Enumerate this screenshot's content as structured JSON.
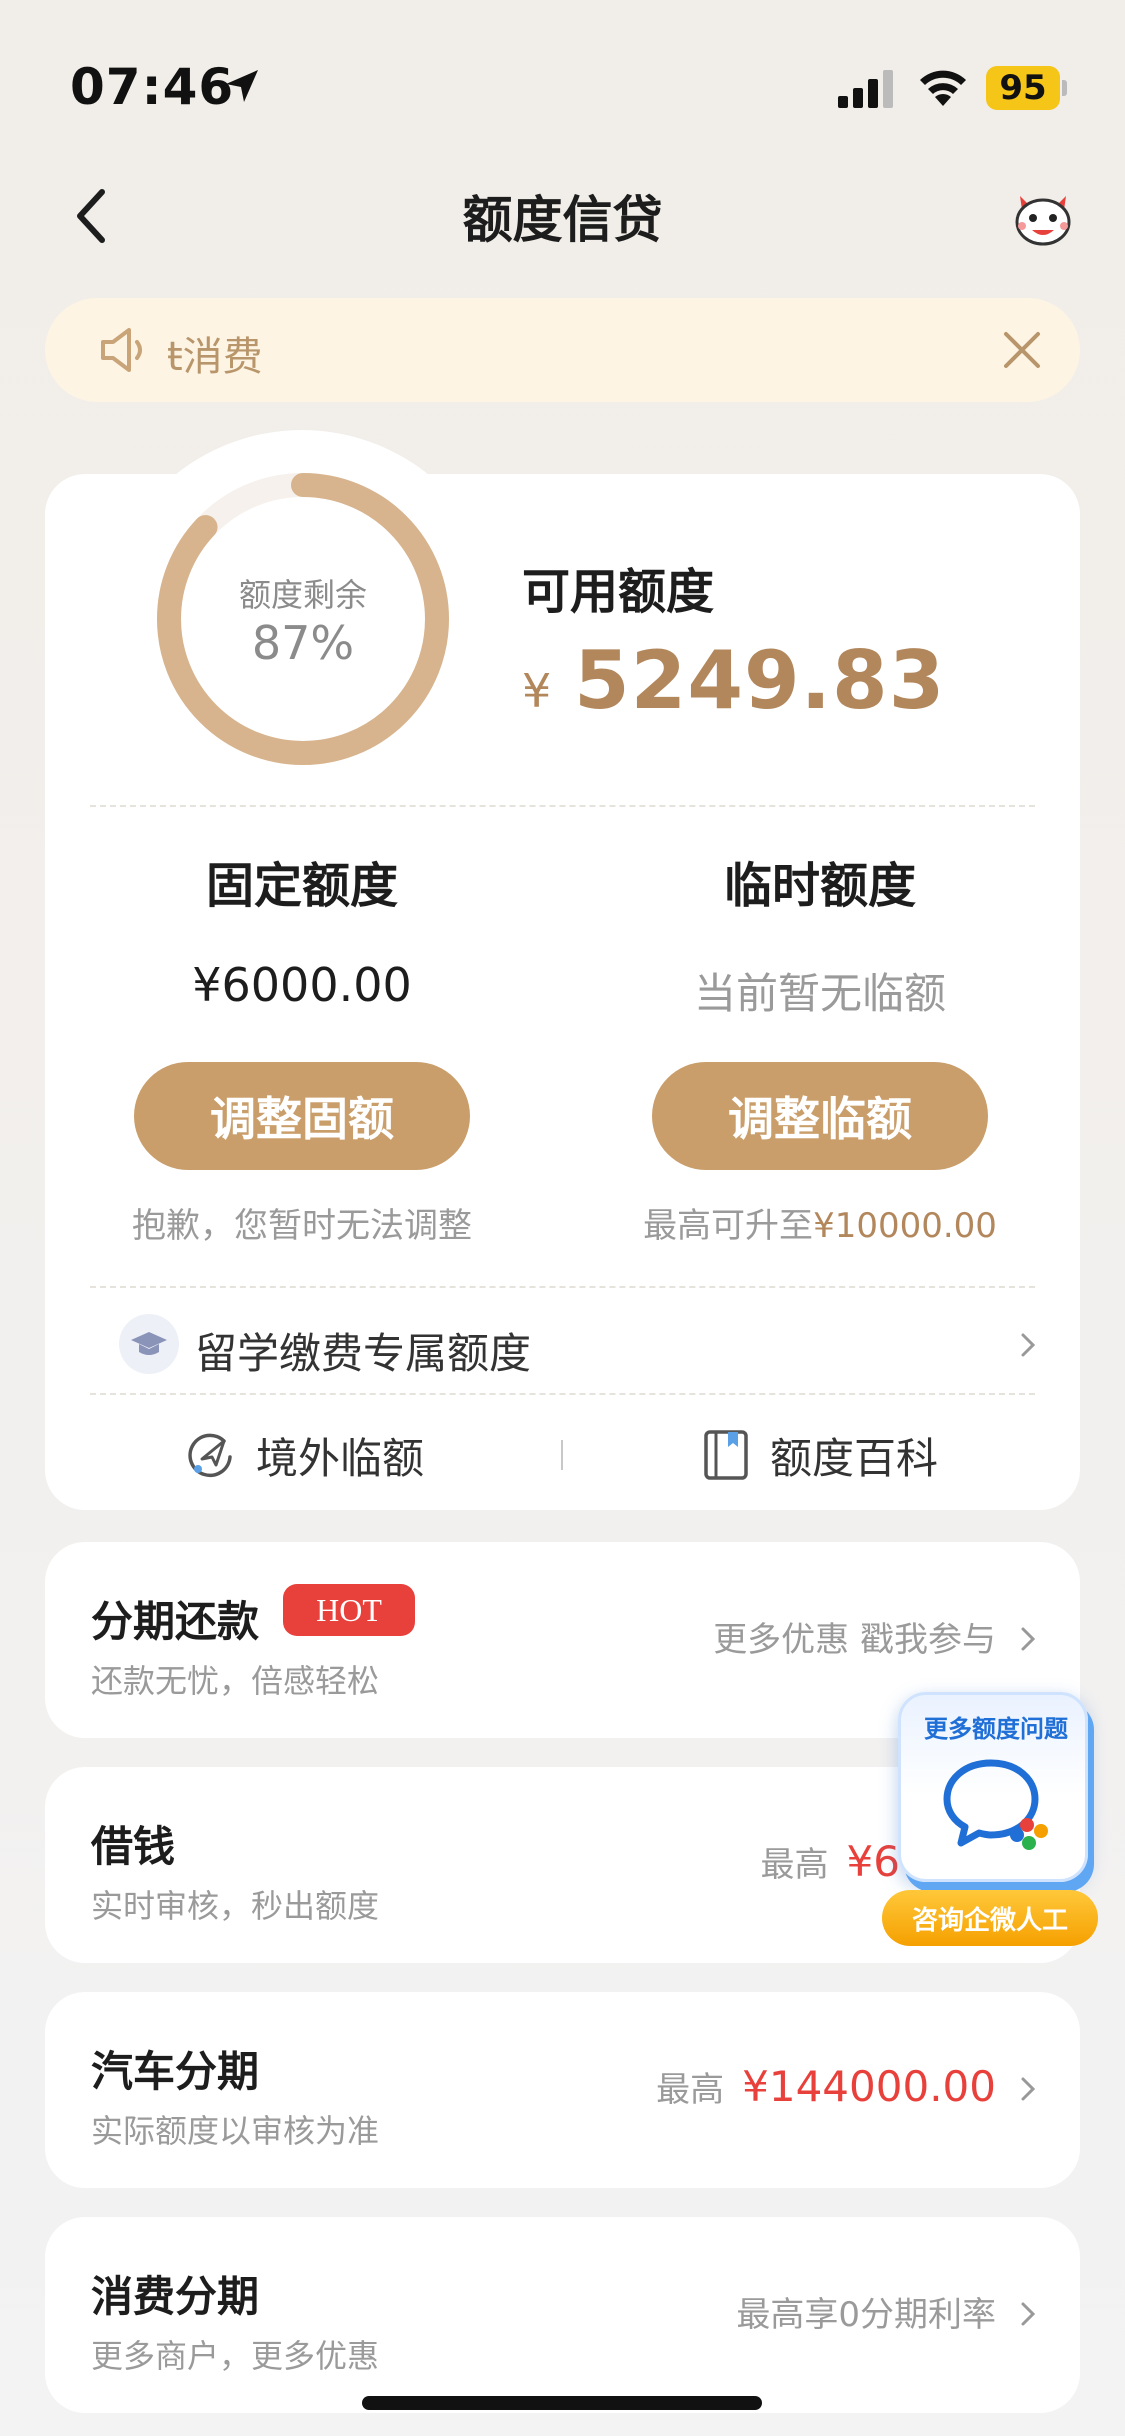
{
  "status_bar": {
    "time": "07:46",
    "battery": "95"
  },
  "nav": {
    "title": "额度信贷"
  },
  "notice": {
    "text": "ŧ消费"
  },
  "credit": {
    "ring_label": "额度剩余",
    "ring_percent": "87%",
    "ring_fraction": 0.87,
    "available_label": "可用额度",
    "currency": "¥",
    "available_amount": "5249.83",
    "fixed": {
      "title": "固定额度",
      "value": "¥6000.00",
      "button": "调整固额",
      "note": "抱歉，您暂时无法调整"
    },
    "temporary": {
      "title": "临时额度",
      "value": "当前暂无临额",
      "button": "调整临额",
      "note_prefix": "最高可升至",
      "note_amount": "¥10000.00"
    },
    "study_row": "留学缴费专属额度",
    "links": {
      "overseas": "境外临额",
      "wiki": "额度百科"
    }
  },
  "list": [
    {
      "title": "分期还款",
      "badge": "HOT",
      "subtitle": "还款无忧，倍感轻松",
      "right_text": "更多优惠 戳我参与",
      "amount": ""
    },
    {
      "title": "借钱",
      "badge": "",
      "subtitle": "实时审核，秒出额度",
      "right_text": "最高",
      "amount": "¥6"
    },
    {
      "title": "汽车分期",
      "badge": "",
      "subtitle": "实际额度以审核为准",
      "right_text": "最高",
      "amount": "¥144000.00"
    },
    {
      "title": "消费分期",
      "badge": "",
      "subtitle": "更多商户，更多优惠",
      "right_text": "最高享0分期利率",
      "amount": ""
    }
  ],
  "float": {
    "title": "更多额度问题",
    "button": "咨询企微人工"
  },
  "colors": {
    "accent": "#c99e6b",
    "gold_text": "#b3875c",
    "red": "#e8413c",
    "notice_bg": "#fdf4e3"
  }
}
